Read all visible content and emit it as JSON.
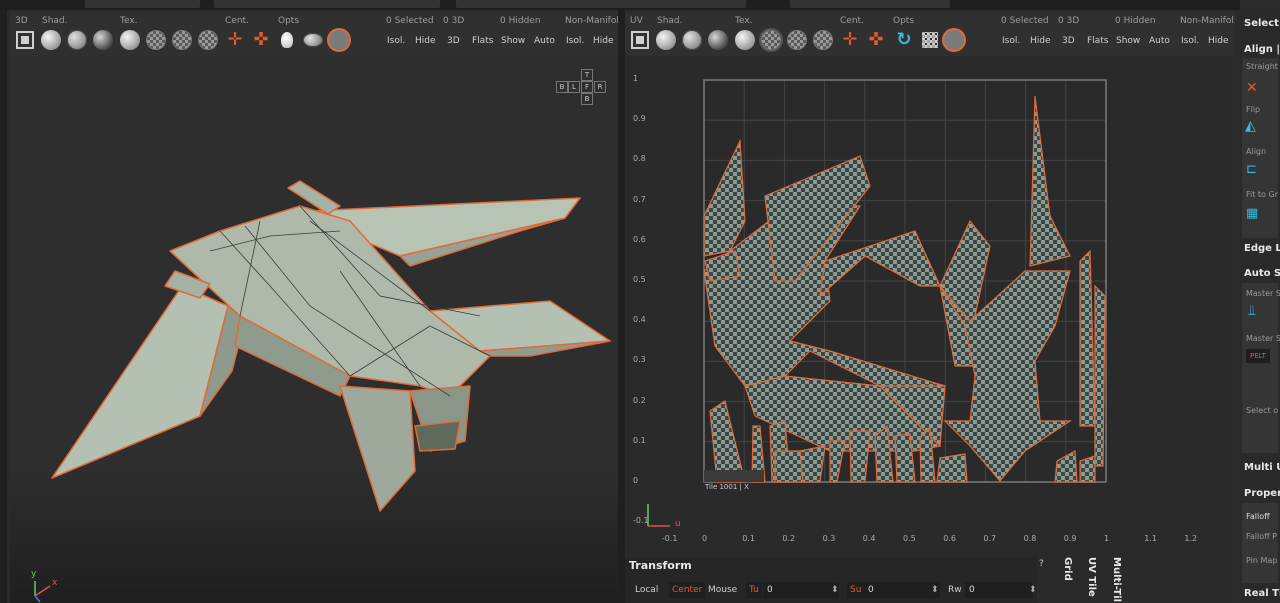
{
  "left_viewport": {
    "headers": {
      "d3": "3D",
      "shad": "Shad.",
      "tex": "Tex.",
      "cent": "Cent.",
      "opts": "Opts",
      "selected": "0 Selected",
      "d3b": "0 3D",
      "hidden": "0 Hidden",
      "nonmanifold": "Non-Manifol"
    },
    "buttons": {
      "isol": "Isol.",
      "hide": "Hide",
      "d3": "3D",
      "flats": "Flats",
      "show": "Show",
      "auto": "Auto",
      "isol2": "Isol.",
      "hide2": "Hide"
    },
    "navcube": {
      "t": "T",
      "b": "B",
      "l": "L",
      "f": "F",
      "r": "R",
      "bk": "B"
    }
  },
  "right_viewport": {
    "headers": {
      "uv": "UV",
      "shad": "Shad.",
      "tex": "Tex.",
      "cent": "Cent.",
      "opts": "Opts",
      "selected": "0 Selected",
      "d3b": "0 3D",
      "hidden": "0 Hidden",
      "nonmanifold": "Non-Manifol"
    },
    "buttons": {
      "isol": "Isol.",
      "hide": "Hide",
      "d3": "3D",
      "flats": "Flats",
      "show": "Show",
      "auto": "Auto",
      "isol2": "Isol.",
      "hide2": "Hide"
    },
    "tile_label": "Tile 1001 | X",
    "axis_u": "u",
    "y_ticks": [
      "1",
      "0.9",
      "0.8",
      "0.7",
      "0.6",
      "0.5",
      "0.4",
      "0.3",
      "0.2",
      "0.1",
      "0",
      "-0.1"
    ],
    "x_ticks": [
      "-0.1",
      "0",
      "0.1",
      "0.2",
      "0.3",
      "0.4",
      "0.5",
      "0.6",
      "0.7",
      "0.8",
      "0.9",
      "1",
      "1.1",
      "1.2"
    ]
  },
  "axes_left": {
    "x": "x",
    "y": "y"
  },
  "side_panel": {
    "select": "Select",
    "align": "Align |",
    "straighten": "Straight",
    "flip": "Flip",
    "align_sub": "Align",
    "fit": "Fit to Gr",
    "edge_loop": "Edge Lo",
    "auto_seams": "Auto Se",
    "master1": "Master S",
    "master2": "Master S",
    "pelt": "PELT",
    "select_o": "Select o",
    "multi": "Multi U",
    "properties": "Proper",
    "falloff": "Falloff",
    "falloff_p": "Falloff P",
    "pin_map": "Pin Map",
    "real_tile": "Real Ti"
  },
  "transform": {
    "title": "Transform",
    "local": "Local",
    "center": "Center",
    "mouse": "Mouse",
    "tu": "Tu",
    "tu_val": "0",
    "su": "Su",
    "su_val": "0",
    "rw": "Rw",
    "rw_val": "0",
    "help": "?"
  },
  "tabs": {
    "grid": "Grid",
    "uv_tile": "UV Tile",
    "multi_tile": "Multi-Til"
  },
  "colors": {
    "accent": "#e06a3a",
    "mesh": "#a8b5a5",
    "checker_a": "#8c9a94",
    "checker_b": "#3d4845"
  }
}
